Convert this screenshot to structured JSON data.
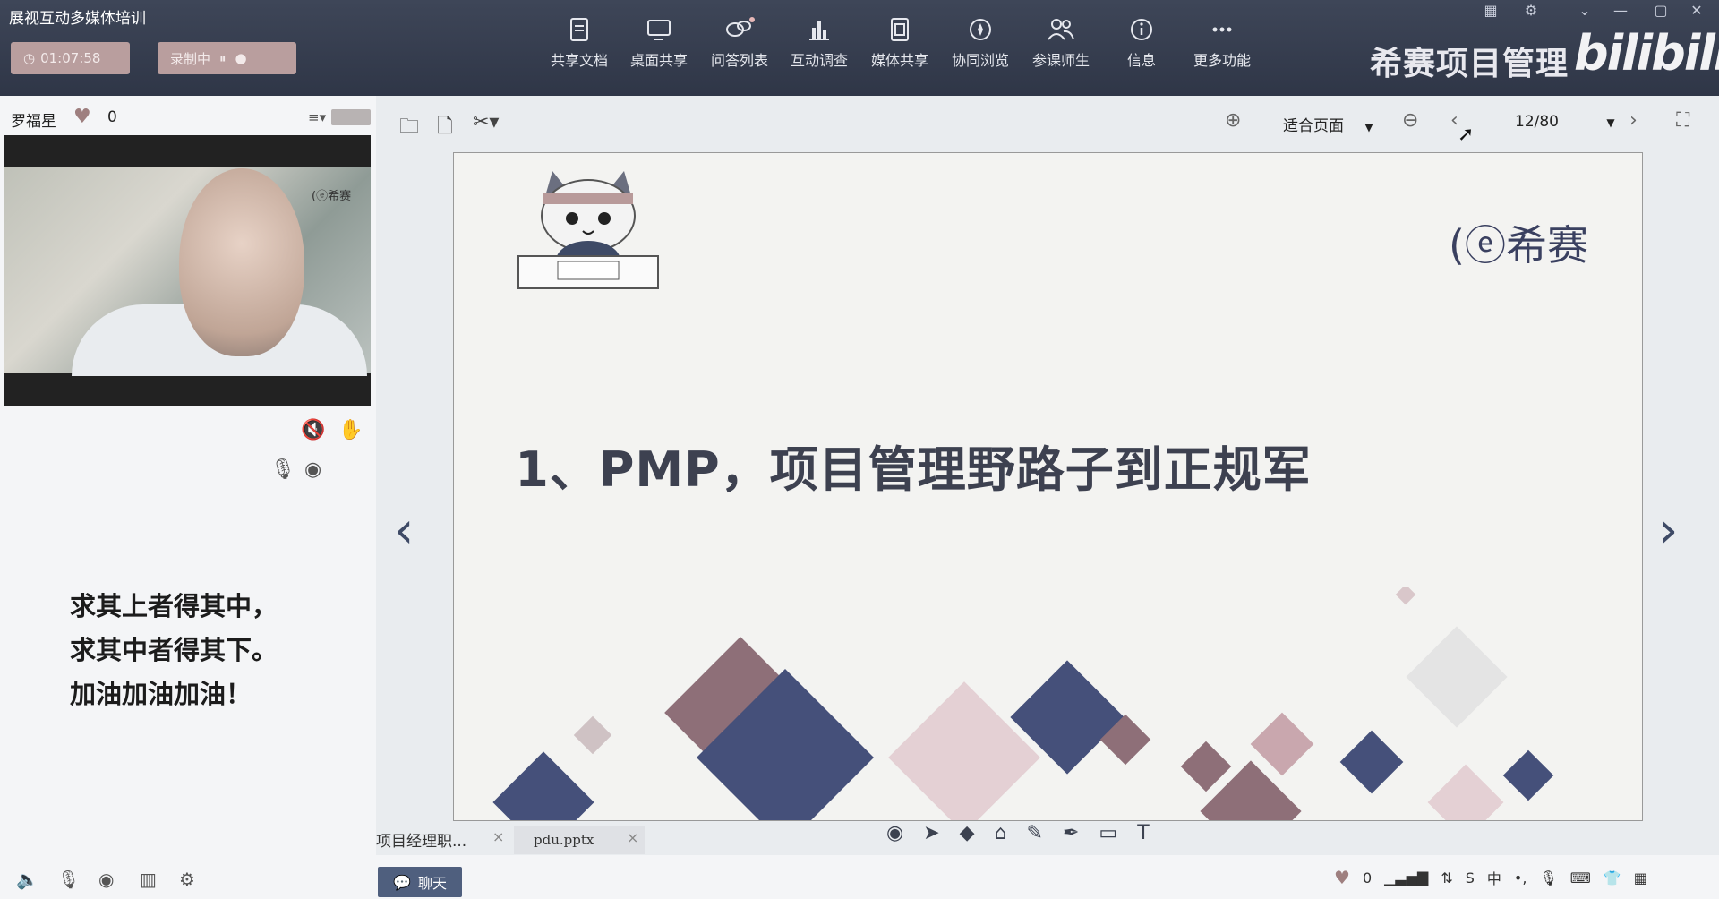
{
  "app": {
    "title": "展视互动多媒体培训"
  },
  "status": {
    "timer": "01:07:58",
    "record_label": "录制中"
  },
  "toolbar": {
    "items": [
      {
        "label": "共享文档",
        "icon": "document-icon"
      },
      {
        "label": "桌面共享",
        "icon": "desktop-icon"
      },
      {
        "label": "问答列表",
        "icon": "chat-bubbles-icon"
      },
      {
        "label": "互动调查",
        "icon": "bar-chart-icon"
      },
      {
        "label": "媒体共享",
        "icon": "film-icon"
      },
      {
        "label": "协同浏览",
        "icon": "compass-icon"
      },
      {
        "label": "参课师生",
        "icon": "people-icon"
      },
      {
        "label": "信息",
        "icon": "info-icon"
      },
      {
        "label": "更多功能",
        "icon": "more-icon"
      }
    ]
  },
  "brand": {
    "name": "希赛项目管理",
    "watermark": "bilibili"
  },
  "host": {
    "name": "罗福星",
    "likes": "0",
    "video_logo": "希赛"
  },
  "motto": {
    "line1": "求其上者得其中，",
    "line2": "求其中者得其下。",
    "line3": "加油加油加油！"
  },
  "viewer": {
    "zoom_label": "适合页面",
    "page_indicator": "12/80"
  },
  "slide": {
    "title": "1、PMP，项目管理野路子到正规军",
    "logo_text": "希赛"
  },
  "doc_tabs": [
    {
      "label": "项目经理职..."
    },
    {
      "label": "pdu.pptx"
    }
  ],
  "chat": {
    "label": "聊天"
  },
  "bottom": {
    "likes": "0"
  },
  "colors": {
    "topbar": "#363e50",
    "accent": "#4f5f7e",
    "pill": "#b99e9e"
  }
}
